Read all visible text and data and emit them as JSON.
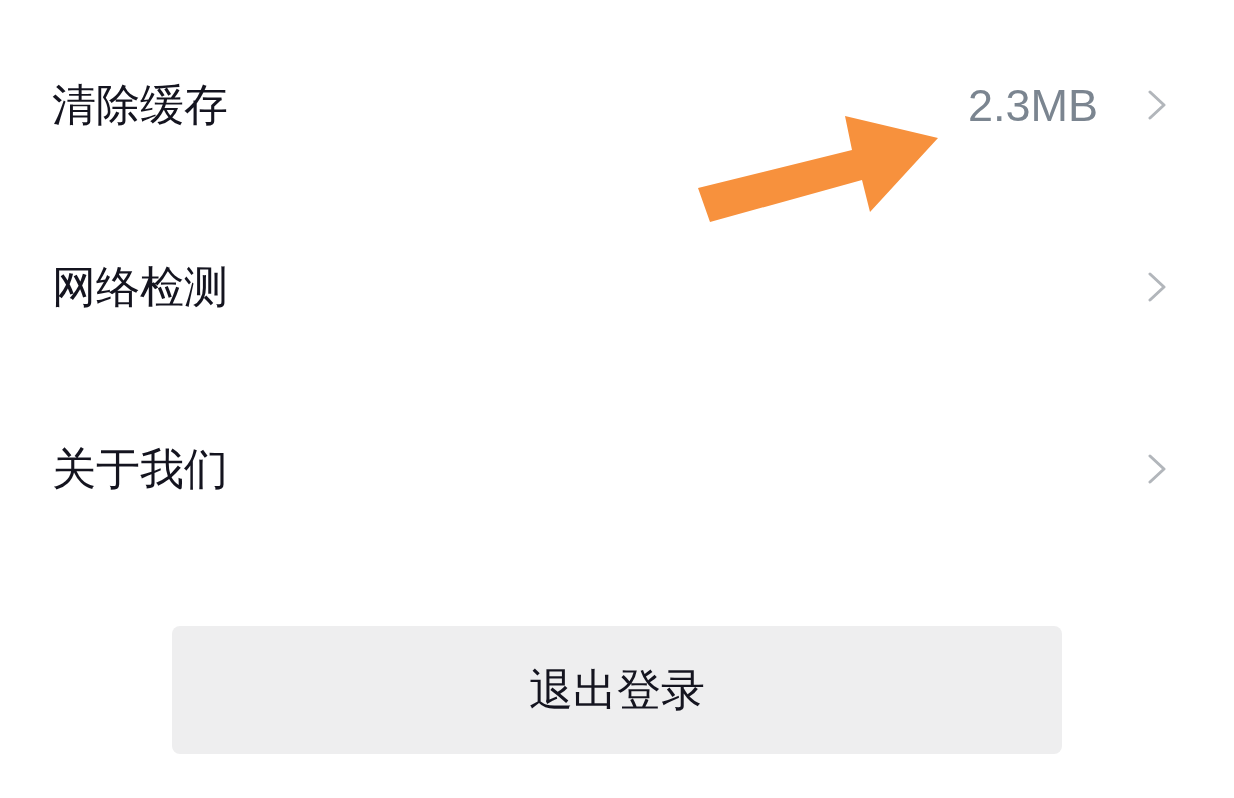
{
  "settings": [
    {
      "label": "清除缓存",
      "value": "2.3MB"
    },
    {
      "label": "网络检测"
    },
    {
      "label": "关于我们"
    }
  ],
  "logout_button": {
    "label": "退出登录"
  }
}
